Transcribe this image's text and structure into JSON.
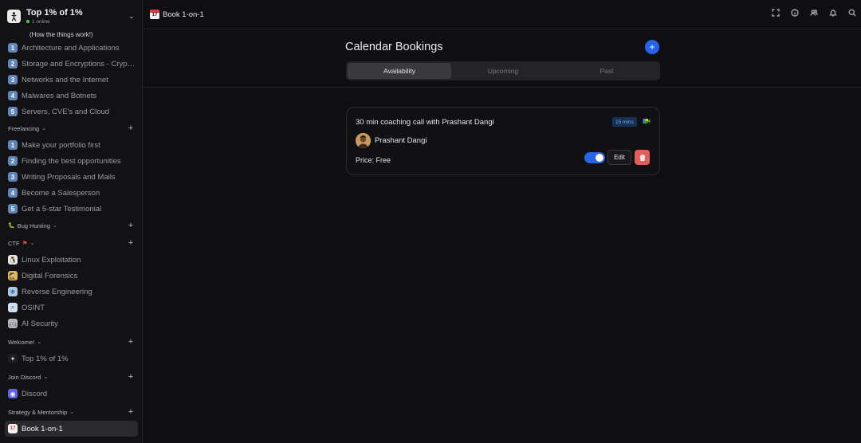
{
  "workspace": {
    "name": "Top 1% of 1%",
    "online": "1 online"
  },
  "sidebar": {
    "subnote": "(How the things work!)",
    "group1": [
      {
        "num": "1",
        "label": "Architecture and Applications"
      },
      {
        "num": "2",
        "label": "Storage and Encryptions - Cryptography"
      },
      {
        "num": "3",
        "label": "Networks and the Internet"
      },
      {
        "num": "4",
        "label": "Malwares and Botnets"
      },
      {
        "num": "5",
        "label": "Servers, CVE's and Cloud"
      }
    ],
    "freelancing": {
      "title": "Freelancing",
      "items": [
        {
          "num": "1",
          "label": "Make your portfolio first"
        },
        {
          "num": "2",
          "label": "Finding the best opportunities"
        },
        {
          "num": "3",
          "label": "Writing Proposals and Mails"
        },
        {
          "num": "4",
          "label": "Become a Salesperson"
        },
        {
          "num": "5",
          "label": "Get a 5-star Testimonial"
        }
      ]
    },
    "bug_hunting": {
      "title": "Bug Hunting",
      "icon": "bug-icon"
    },
    "ctf": {
      "title": "CTF",
      "icon": "red-flag-icon",
      "items": [
        {
          "label": "Linux Exploitation",
          "icon": "penguin-icon"
        },
        {
          "label": "Digital Forensics",
          "icon": "detective-icon"
        },
        {
          "label": "Reverse Engineering",
          "icon": "snowflake-icon"
        },
        {
          "label": "OSINT",
          "icon": "magnifier-icon"
        },
        {
          "label": "AI Security",
          "icon": "robot-icon"
        }
      ]
    },
    "welcome": {
      "title": "Welcome!",
      "items": [
        {
          "label": "Top 1% of 1%",
          "icon": "logo-icon"
        }
      ]
    },
    "discord": {
      "title": "Join Discord",
      "items": [
        {
          "label": "Discord",
          "icon": "discord-icon"
        }
      ]
    },
    "strategy": {
      "title": "Strategy & Mentorship",
      "items": [
        {
          "label": "Book 1-on-1",
          "icon": "calendar-icon"
        }
      ]
    }
  },
  "topbar": {
    "title": "Book 1-on-1",
    "cal_day": "17"
  },
  "main": {
    "title": "Calendar Bookings",
    "add_label": "+",
    "tabs": [
      {
        "label": "Availability"
      },
      {
        "label": "Upcoming"
      },
      {
        "label": "Past"
      }
    ],
    "active_tab": "Availability"
  },
  "booking": {
    "title": "30 min coaching call with Prashant Dangi",
    "duration": "15 mins",
    "host": "Prashant Dangi",
    "price": "Price: Free",
    "enabled": true,
    "edit_label": "Edit"
  },
  "colors": {
    "accent": "#2563eb",
    "danger": "#e35d5b",
    "number_badge": "#5f86b6"
  }
}
